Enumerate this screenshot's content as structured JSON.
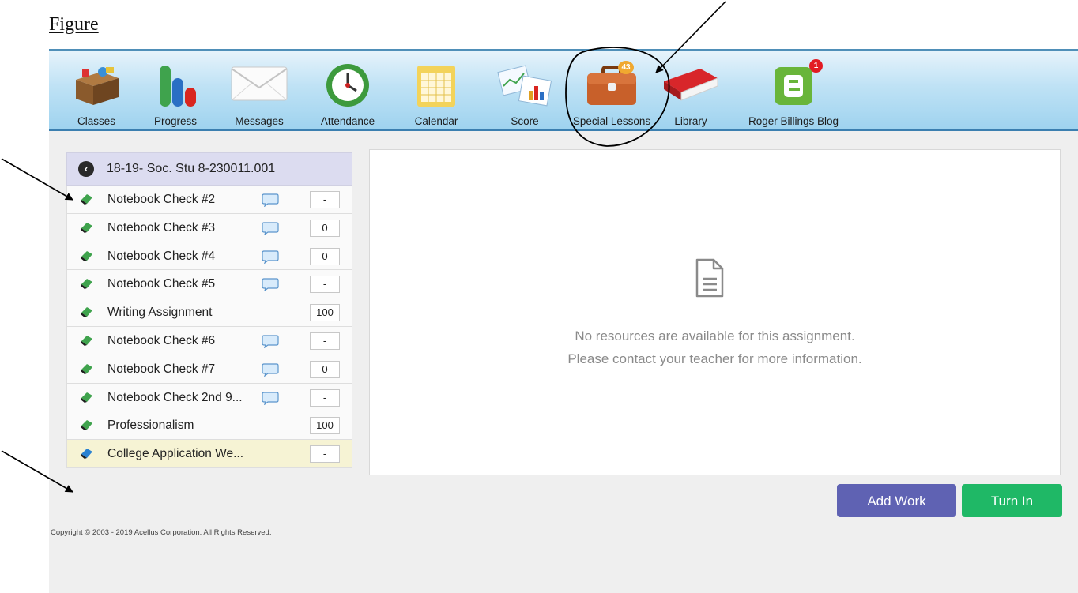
{
  "figure_title": "Figure",
  "nav": [
    {
      "label": "Classes",
      "icon": "desk-icon"
    },
    {
      "label": "Progress",
      "icon": "progress-bars-icon"
    },
    {
      "label": "Messages",
      "icon": "envelope-icon"
    },
    {
      "label": "Attendance",
      "icon": "clock-icon"
    },
    {
      "label": "Calendar",
      "icon": "calendar-icon"
    },
    {
      "label": "Score",
      "icon": "score-charts-icon"
    },
    {
      "label": "Special Lessons",
      "icon": "briefcase-icon",
      "badge": "43"
    },
    {
      "label": "Library",
      "icon": "book-icon"
    },
    {
      "label": "Roger Billings Blog",
      "icon": "blogger-icon",
      "badge": "1"
    }
  ],
  "sidebar": {
    "course": "18-19- Soc. Stu 8-230011.001",
    "items": [
      {
        "label": "Notebook Check #2",
        "score": "-",
        "comment": true
      },
      {
        "label": "Notebook Check #3",
        "score": "0",
        "comment": true
      },
      {
        "label": "Notebook Check #4",
        "score": "0",
        "comment": true
      },
      {
        "label": "Notebook Check #5",
        "score": "-",
        "comment": true
      },
      {
        "label": "Writing Assignment",
        "score": "100",
        "comment": false
      },
      {
        "label": "Notebook Check #6",
        "score": "-",
        "comment": true
      },
      {
        "label": "Notebook Check #7",
        "score": "0",
        "comment": true
      },
      {
        "label": "Notebook Check 2nd 9...",
        "score": "-",
        "comment": true
      },
      {
        "label": "Professionalism",
        "score": "100",
        "comment": false
      },
      {
        "label": "College Application We...",
        "score": "-",
        "comment": false,
        "selected": true
      }
    ]
  },
  "content": {
    "line1": "No resources are available for this assignment.",
    "line2": "Please contact your teacher for more information."
  },
  "buttons": {
    "add_work": "Add Work",
    "turn_in": "Turn In"
  },
  "footer": {
    "copyright": "Copyright © 2003 - 2019 Acellus Corporation.  All Rights Reserved."
  },
  "colors": {
    "add_work": "#5f62b3",
    "turn_in": "#1fb866",
    "topbar": "#9fd3ef",
    "badge": "#f0a830",
    "badge_red": "#e21b23"
  }
}
